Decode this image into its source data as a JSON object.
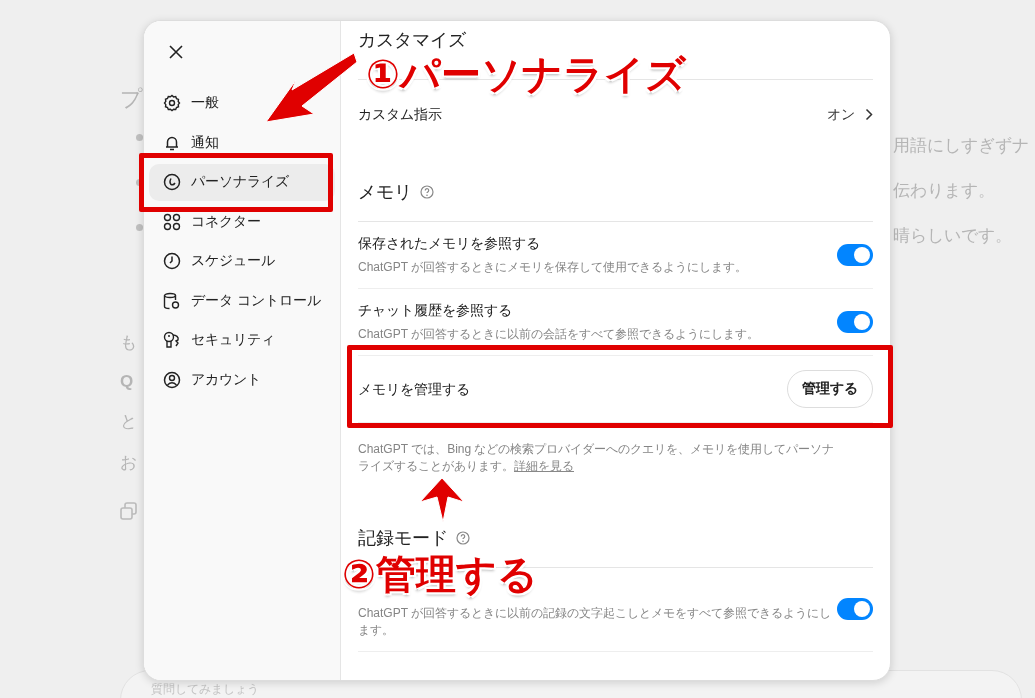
{
  "background": {
    "left_texts": [
      {
        "text": "プ",
        "bold": false
      },
      {
        "text": "も",
        "bold": false
      },
      {
        "text": "Q",
        "bold": true
      },
      {
        "text": "と",
        "bold": false
      },
      {
        "text": "お",
        "bold": false
      }
    ],
    "right_texts": [
      "用語にしすぎずナ",
      "伝わります。",
      "晴らしいです。"
    ],
    "input_placeholder": "質問してみましょう"
  },
  "sidebar": {
    "items": [
      {
        "label": "一般",
        "selected": false
      },
      {
        "label": "通知",
        "selected": false
      },
      {
        "label": "パーソナライズ",
        "selected": true
      },
      {
        "label": "コネクター",
        "selected": false
      },
      {
        "label": "スケジュール",
        "selected": false
      },
      {
        "label": "データ コントロール",
        "selected": false
      },
      {
        "label": "セキュリティ",
        "selected": false
      },
      {
        "label": "アカウント",
        "selected": false
      }
    ]
  },
  "content": {
    "header": "カスタマイズ",
    "sections": [
      {
        "rows": [
          {
            "kind": "link",
            "label": "カスタム指示",
            "value": "オン"
          }
        ]
      },
      {
        "title": "メモリ",
        "help": true,
        "rows": [
          {
            "kind": "toggle",
            "label": "保存されたメモリを参照する",
            "description": "ChatGPT が回答するときにメモリを保存して使用できるようにします。",
            "on": true
          },
          {
            "kind": "toggle",
            "label": "チャット履歴を参照する",
            "description": "ChatGPT が回答するときに以前の会話をすべて参照できるようにします。",
            "on": true
          },
          {
            "kind": "button",
            "label": "メモリを管理する",
            "button": "管理する"
          },
          {
            "kind": "note",
            "text": "ChatGPT では、Bing などの検索プロバイダーへのクエリを、メモリを使用してパーソナライズすることがあります。",
            "link": "詳細を見る"
          }
        ]
      },
      {
        "title": "記録モード",
        "help": true,
        "rows": [
          {
            "kind": "toggle",
            "description": "ChatGPT が回答するときに以前の記録の文字起こしとメモをすべて参照できるようにします。",
            "on": true
          }
        ]
      }
    ]
  },
  "annotations": [
    {
      "kind": "label",
      "text": "①パーソナライズ"
    },
    {
      "kind": "label",
      "text": "②管理する"
    }
  ]
}
